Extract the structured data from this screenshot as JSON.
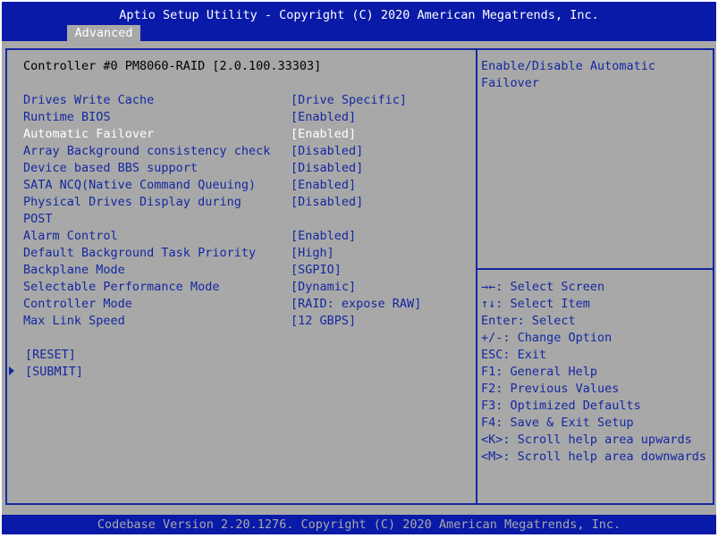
{
  "header": {
    "title": "Aptio Setup Utility - Copyright (C) 2020 American Megatrends, Inc.",
    "tab": "Advanced"
  },
  "main": {
    "controller_title": "Controller #0 PM8060-RAID [2.0.100.33303]",
    "settings": [
      {
        "label": "Drives Write Cache",
        "value": "[Drive Specific]"
      },
      {
        "label": "Runtime BIOS",
        "value": "[Enabled]"
      },
      {
        "label": "Automatic Failover",
        "value": "[Enabled]"
      },
      {
        "label": "Array Background consistency check",
        "value": "[Disabled]"
      },
      {
        "label": "Device based BBS support",
        "value": "[Disabled]"
      },
      {
        "label": "SATA NCQ(Native Command Queuing)",
        "value": "[Enabled]"
      },
      {
        "label": "Physical Drives Display during",
        "label2": "POST",
        "value": "[Disabled]"
      },
      {
        "label": "Alarm Control",
        "value": "[Enabled]"
      },
      {
        "label": "Default Background Task Priority",
        "value": "[High]"
      },
      {
        "label": "Backplane Mode",
        "value": "[SGPIO]"
      },
      {
        "label": "Selectable Performance Mode",
        "value": "[Dynamic]"
      },
      {
        "label": "Controller Mode",
        "value": "[RAID: expose RAW]"
      },
      {
        "label": "Max Link Speed",
        "value": "[12 GBPS]"
      }
    ],
    "reset": "[RESET]",
    "submit": "[SUBMIT]"
  },
  "help": {
    "line1": "Enable/Disable Automatic",
    "line2": "Failover"
  },
  "keys": [
    "→←: Select Screen",
    "↑↓: Select Item",
    "Enter: Select",
    "+/-: Change Option",
    "ESC: Exit",
    "F1: General Help",
    "F2: Previous Values",
    "F3: Optimized Defaults",
    "F4: Save & Exit Setup",
    "<K>: Scroll help area upwards",
    "<M>: Scroll help area downwards"
  ],
  "footer": {
    "text": "Codebase Version 2.20.1276. Copyright (C) 2020 American Megatrends, Inc."
  },
  "colors": {
    "header_bg": "#0a1aa8",
    "panel_bg": "#a8a8a8",
    "accent_blue": "#1428a0",
    "selected_text": "#ffffff"
  }
}
